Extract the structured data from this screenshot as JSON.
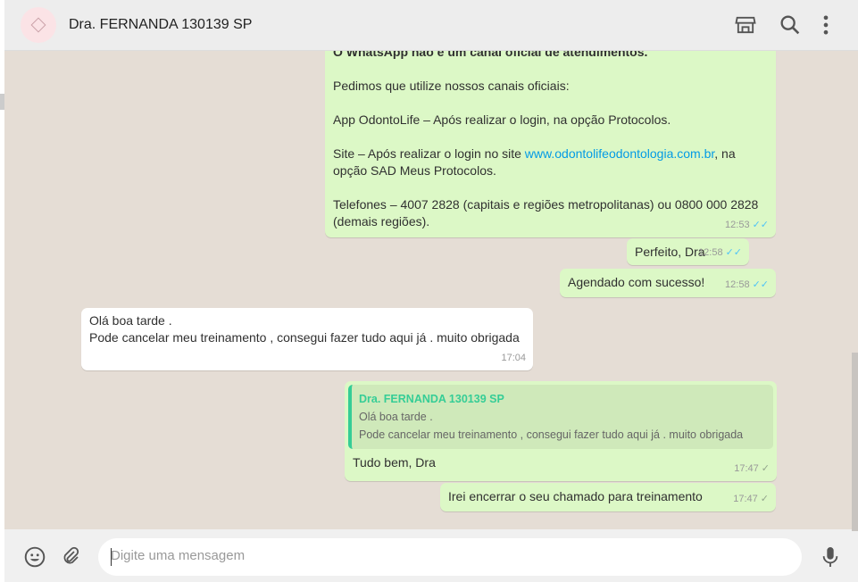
{
  "header": {
    "contact_name": "Dra. FERNANDA 130139 SP",
    "icons": [
      "avatar",
      "shop-icon",
      "search-icon",
      "menu-icon"
    ]
  },
  "messages": [
    {
      "dir": "out",
      "bold": "O WhatsApp não é um canal oficial de atendimentos.",
      "p1": "Pedimos que utilize nossos canais oficiais:",
      "p2": "App OdontoLife – Após realizar o login, na opção Protocolos.",
      "p3a": "Site – Após realizar o login no site ",
      "link": "www.odontolifeodontologia.com.br",
      "p3b": ", na opção SAD Meus Protocolos.",
      "p4": "Telefones – 4007 2828 (capitais e regiões metropolitanas) ou 0800 000 2828 (demais regiões).",
      "time": "12:53",
      "status": "read"
    },
    {
      "dir": "out",
      "text": "Perfeito, Dra",
      "time": "12:58",
      "status": "read"
    },
    {
      "dir": "out",
      "text": "Agendado com sucesso!",
      "time": "12:58",
      "status": "read"
    },
    {
      "dir": "in",
      "line1": "Olá boa tarde .",
      "line2": "Pode cancelar meu treinamento , consegui fazer tudo aqui já . muito obrigada",
      "time": "17:04"
    },
    {
      "dir": "out",
      "quote_name": "Dra. FERNANDA 130139 SP",
      "quote_line1": "Olá boa tarde .",
      "quote_line2": "Pode cancelar meu treinamento , consegui fazer tudo aqui já . muito obrigada",
      "text": "Tudo bem, Dra",
      "time": "17:47",
      "status": "sent"
    },
    {
      "dir": "out",
      "text": "Irei encerrar o seu chamado para treinamento",
      "time": "17:47",
      "status": "sent"
    }
  ],
  "footer": {
    "placeholder": "Digite uma mensagem",
    "tick_read": "✓✓",
    "tick_sent": "✓"
  }
}
